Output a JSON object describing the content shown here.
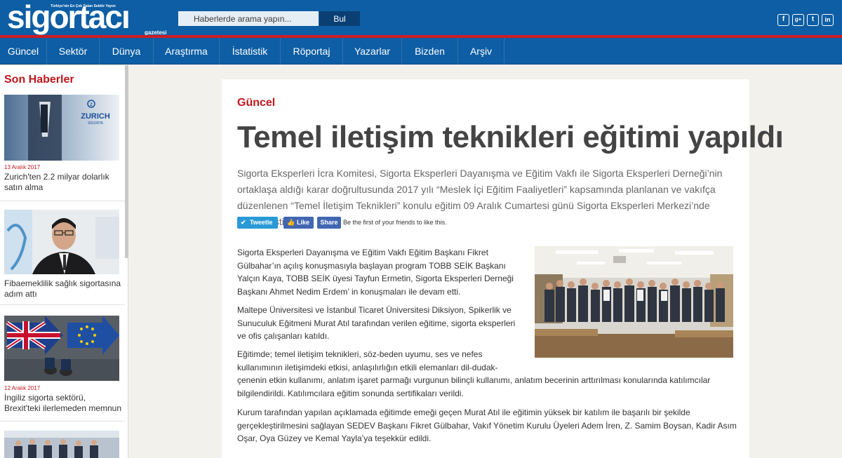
{
  "header": {
    "logo": "sigortacı",
    "logo_tagline": "Türkiye'nin En Çok Satan Sektör Yayını",
    "logo_sub": "gazetesi",
    "search_placeholder": "Haberlerde arama yapın...",
    "search_button": "Bul",
    "social": [
      "f",
      "g+",
      "t",
      "in"
    ],
    "colors": {
      "brand_blue": "#0d5ea4",
      "accent_red": "#d01c23"
    }
  },
  "nav": {
    "items": [
      "Güncel",
      "Sektör",
      "Dünya",
      "Araştırma",
      "İstatistik",
      "Röportaj",
      "Yazarlar",
      "Bizden",
      "Arşiv"
    ]
  },
  "sidebar": {
    "title": "Son Haberler",
    "news": [
      {
        "date": "13 Aralık 2017",
        "title": "Zurich'ten 2.2 milyar dolarlık satın alma",
        "image_label": "ZURICH",
        "image_sub": "SİGORTA"
      },
      {
        "date": "",
        "title": "Fibaemeklilik sağlık sigortasına adım attı"
      },
      {
        "date": "12 Aralık 2017",
        "title": "İngiliz sigorta sektörü, Brexit'teki ilerlemeden memnun"
      },
      {
        "date": "",
        "title": ""
      }
    ]
  },
  "article": {
    "category": "Güncel",
    "headline": "Temel iletişim teknikleri eğitimi yapıldı",
    "lead": "Sigorta Eksperleri İcra Komitesi, Sigorta Eksperleri Dayanışma ve Eğitim Vakfı ile Sigorta Eksperleri Derneği’nin ortaklaşa aldığı karar doğrultusunda 2017 yılı “Meslek İçi Eğitim Faaliyetleri” kapsamında planlanan ve vakıfça düzenlenen “Temel İletişim Teknikleri” konulu eğitim 09 Aralık Cumartesi günü Sigorta Eksperleri Merkezi’nde gerçekleştirildi.",
    "share": {
      "tweet": "Tweetle",
      "like": "Like",
      "share": "Share",
      "fb_text": "Be the first of your friends to like this."
    },
    "paragraphs": [
      "Sigorta Eksperleri Dayanışma ve Eğitim Vakfı Eğitim Başkanı Fikret Gülbahar’ın açılış konuşmasıyla başlayan program TOBB SEİK Başkanı Yalçın Kaya, TOBB SEİK üyesi Tayfun Ermetin, Sigorta Eksperleri Derneği Başkanı Ahmet Nedim Erdem’ in konuşmaları ile devam etti.",
      "Maltepe Üniversitesi ve İstanbul Ticaret Üniversitesi Diksiyon, Spikerlik ve Sunuculuk Eğitmeni Murat Atıl tarafından verilen eğitime, sigorta eksperleri ve ofis çalışanları katıldı.",
      "Eğitimde; temel iletişim teknikleri, söz-beden uyumu, ses ve nefes kullanımının iletişimdeki etkisi, anlaşılırlığın etkili elemanları dil-dudak-çenenin etkin kullanımı, anlatım işaret parmağı vurgunun bilinçli kullanımı, anlatım becerinin arttırılması konularında katılımcılar bilgilendirildi. Katılımcılara eğitim sonunda sertifikaları verildi.",
      "Kurum tarafından yapılan açıklamada eğitimde emeği geçen Murat Atıl ile eğitimin yüksek bir katılım ile başarılı bir şekilde gerçekleştirilmesini sağlayan SEDEV Başkanı Fikret Gülbahar, Vakıf Yönetim Kurulu Üyeleri Adem İren, Z. Samim Boysan, Kadir Asım Oşar, Oya Güzey ve Kemal Yayla’ya  teşekkür edildi."
    ],
    "para_lines": [
      [
        "Sigorta Eksperleri Dayanışma ve Eğitim Vakfı Eğitim Başkanı Fikret",
        "Gülbahar’ın açılış konuşmasıyla başlayan program TOBB SEİK Başkanı",
        "Yalçın Kaya, TOBB SEİK üyesi Tayfun Ermetin, Sigorta Eksperleri Derneği",
        "Başkanı Ahmet Nedim Erdem’ in konuşmaları ile devam etti."
      ],
      [
        "Maltepe Üniversitesi ve İstanbul Ticaret Üniversitesi Diksiyon, Spikerlik ve",
        "Sunuculuk Eğitmeni Murat Atıl tarafından verilen eğitime, sigorta eksperleri",
        "ve ofis çalışanları katıldı."
      ],
      [
        "Eğitimde; temel iletişim teknikleri, söz-beden uyumu, ses ve nefes",
        "kullanımının iletişimdeki etkisi, anlaşılırlığın etkili elemanları dil-dudak-",
        "çenenin etkin kullanımı, anlatım işaret parmağı vurgunun bilinçli kullanımı, anlatım becerinin arttırılması konularında katılımcılar",
        "bilgilendirildi. Katılımcılara eğitim sonunda sertifikaları verildi."
      ],
      [
        "Kurum tarafından yapılan açıklamada eğitimde emeği geçen Murat Atıl ile eğitimin yüksek bir katılım ile başarılı bir şekilde",
        "gerçekleştirilmesini sağlayan SEDEV Başkanı Fikret Gülbahar, Vakıf Yönetim Kurulu Üyeleri Adem İren, Z. Samim Boysan, Kadir Asım",
        "Oşar, Oya Güzey ve Kemal Yayla’ya  teşekkür edildi."
      ]
    ]
  }
}
